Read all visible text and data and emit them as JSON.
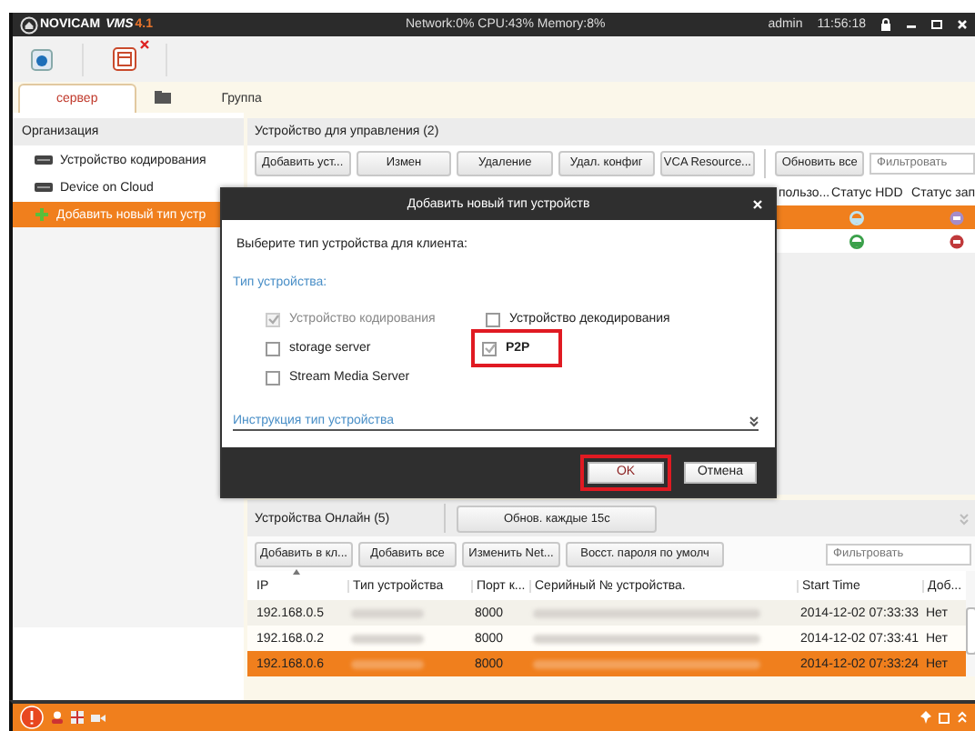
{
  "title_bar": {
    "logo": "NOVICAM",
    "product": "VMS",
    "version": "4.1",
    "stats": "Network:0%  CPU:43%  Memory:8%",
    "user": "admin",
    "time": "11:56:18"
  },
  "tabs": [
    {
      "label": "сервер",
      "selected": true
    },
    {
      "label": "Группа",
      "selected": false
    }
  ],
  "sidebar": {
    "header": "Организация",
    "items": [
      {
        "label": "Устройство кодирования",
        "kind": "device",
        "selected": false
      },
      {
        "label": "Device on Cloud",
        "kind": "device",
        "selected": false
      },
      {
        "label": "Добавить новый тип устр",
        "kind": "add",
        "selected": true
      }
    ]
  },
  "managed": {
    "title": "Устройство для управления (2)",
    "buttons": [
      "Добавить уст...",
      "Измен",
      "Удаление",
      "Удал. конфиг",
      "VCA Resource..."
    ],
    "refresh_button": "Обновить все",
    "filter_placeholder": "Фильтровать",
    "columns": [
      "пользо...",
      "Статус HDD",
      "Статус зап"
    ],
    "rows": [
      {
        "selected": true,
        "hdd": {
          "color": "#bfe3f0"
        },
        "record": {
          "color": "#a58cc8"
        }
      },
      {
        "selected": false,
        "hdd": {
          "color": "#3aa04a"
        },
        "record": {
          "color": "#c0393b"
        }
      }
    ]
  },
  "dialog": {
    "title": "Добавить новый тип устройств",
    "prompt": "Выберите тип устройства для клиента:",
    "section": "Тип устройства:",
    "options": [
      {
        "label": "Устройство кодирования",
        "checked": true,
        "disabled": true,
        "highlighted": false
      },
      {
        "label": "Устройство декодирования",
        "checked": false,
        "disabled": false,
        "highlighted": false
      },
      {
        "label": "storage server",
        "checked": false,
        "disabled": false,
        "highlighted": false
      },
      {
        "label": "P2P",
        "checked": true,
        "disabled": false,
        "highlighted": true
      },
      {
        "label": "Stream Media Server",
        "checked": false,
        "disabled": false,
        "highlighted": false
      }
    ],
    "instructions": "Инструкция тип устройства",
    "buttons": [
      {
        "label": "OK",
        "highlighted": true
      },
      {
        "label": "Отмена",
        "highlighted": false
      }
    ]
  },
  "online": {
    "title": "Устройства Онлайн (5)",
    "refresh_button": "Обнов. каждые 15с",
    "buttons": [
      "Добавить в кл...",
      "Добавить все",
      "Изменить Net...",
      "Восст. пароля по умолч"
    ],
    "filter_placeholder": "Фильтровать",
    "columns": [
      "IP",
      "Тип устройства",
      "Порт к...",
      "Серийный № устройства.",
      "Start Time",
      "Доб..."
    ],
    "rows": [
      {
        "ip": "192.168.0.5",
        "port": "8000",
        "start_time": "2014-12-02 07:33:33",
        "added": "Нет",
        "selected": false
      },
      {
        "ip": "192.168.0.2",
        "port": "8000",
        "start_time": "2014-12-02 07:33:41",
        "added": "Нет",
        "selected": false
      },
      {
        "ip": "192.168.0.6",
        "port": "8000",
        "start_time": "2014-12-02 07:33:24",
        "added": "Нет",
        "selected": true
      }
    ]
  }
}
